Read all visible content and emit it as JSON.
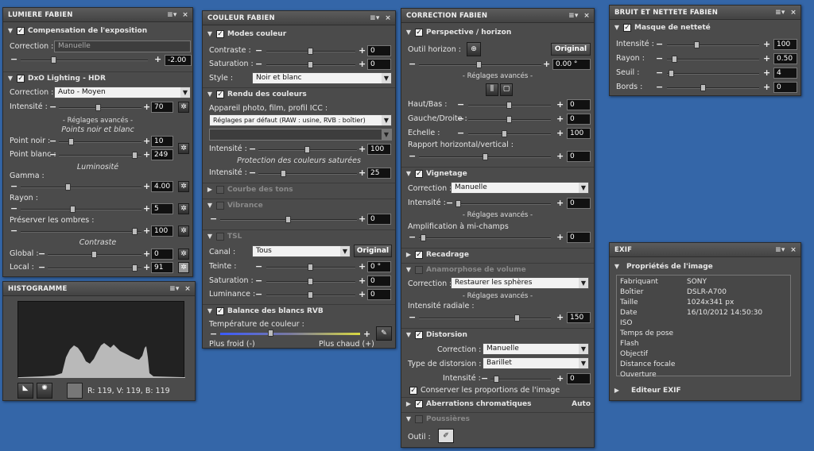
{
  "lumiere": {
    "title": "LUMIERE FABIEN",
    "sec_exposure": "Compensation de l'exposition",
    "correction_label": "Correction :",
    "correction_value": "Manuelle",
    "exposure_value": "-2.00",
    "sec_dxo": "DxO Lighting - HDR",
    "dxo_correction_value": "Auto - Moyen",
    "intensity_label": "Intensité :",
    "intensity_value": "70",
    "advanced": "- Réglages avancés -",
    "points_title": "Points noir et blanc",
    "black_label": "Point noir :",
    "black_value": "10",
    "white_label": "Point blanc :",
    "white_value": "249",
    "luminosity_title": "Luminosité",
    "gamma_label": "Gamma :",
    "gamma_value": "4.00",
    "radius_label": "Rayon :",
    "radius_value": "5",
    "shadows_label": "Préserver les ombres :",
    "shadows_value": "100",
    "contrast_title": "Contraste",
    "global_label": "Global :",
    "global_value": "0",
    "local_label": "Local :",
    "local_value": "91"
  },
  "histogram": {
    "title": "HISTOGRAMME",
    "readout": "R: 119, V: 119, B: 119"
  },
  "couleur": {
    "title": "COULEUR FABIEN",
    "sec_modes": "Modes couleur",
    "contrast_label": "Contraste :",
    "contrast_value": "0",
    "saturation_label": "Saturation :",
    "saturation_value": "0",
    "style_label": "Style :",
    "style_value": "Noir et blanc",
    "sec_render": "Rendu des couleurs",
    "camera_label": "Appareil photo, film, profil ICC :",
    "camera_value": "Réglages par défaut (RAW : usine, RVB : boîtier)",
    "intensity_label": "Intensité :",
    "intensity_value": "100",
    "protection_title": "Protection des couleurs saturées",
    "protection_label": "Intensité :",
    "protection_value": "25",
    "sec_curve": "Courbe des tons",
    "sec_vibrance": "Vibrance",
    "vibrance_value": "0",
    "sec_tsl": "TSL",
    "channel_label": "Canal :",
    "channel_value": "Tous",
    "original_label": "Original",
    "hue_label": "Teinte :",
    "hue_value": "0 °",
    "tsl_sat_label": "Saturation :",
    "tsl_sat_value": "0",
    "luminance_label": "Luminance :",
    "luminance_value": "0",
    "sec_wb": "Balance des blancs RVB",
    "temp_label": "Température de couleur :",
    "cooler": "Plus froid (-)",
    "warmer": "Plus chaud (+)"
  },
  "correction": {
    "title": "CORRECTION FABIEN",
    "sec_perspective": "Perspective / horizon",
    "horizon_label": "Outil horizon :",
    "original_label": "Original",
    "angle_value": "0.00 °",
    "advanced": "- Réglages avancés -",
    "topbottom_label": "Haut/Bas :",
    "topbottom_value": "0",
    "leftright_label": "Gauche/Droite :",
    "leftright_value": "0",
    "scale_label": "Echelle :",
    "scale_value": "100",
    "ratio_label": "Rapport horizontal/vertical :",
    "ratio_value": "0",
    "sec_vignetting": "Vignetage",
    "vig_correction_label": "Correction :",
    "vig_correction_value": "Manuelle",
    "vig_intensity_label": "Intensité :",
    "vig_intensity_value": "0",
    "vig_advanced": "- Réglages avancés -",
    "midfield_label": "Amplification à mi-champs",
    "midfield_value": "0",
    "sec_crop": "Recadrage",
    "sec_anamorph": "Anamorphose de volume",
    "anam_correction_label": "Correction :",
    "anam_correction_value": "Restaurer les sphères",
    "anam_advanced": "- Réglages avancés -",
    "radial_label": "Intensité radiale :",
    "radial_value": "150",
    "sec_distortion": "Distorsion",
    "dist_correction_label": "Correction :",
    "dist_correction_value": "Manuelle",
    "dist_type_label": "Type de distorsion :",
    "dist_type_value": "Barillet",
    "dist_intensity_label": "Intensité :",
    "dist_intensity_value": "0",
    "keep_proportions": "Conserver les proportions de l'image",
    "sec_aberrations": "Aberrations chromatiques",
    "aberrations_mode": "Auto",
    "sec_dust": "Poussières",
    "tool_label": "Outil :"
  },
  "bruit": {
    "title": "BRUIT ET NETTETE FABIEN",
    "sec_mask": "Masque de netteté",
    "intensity_label": "Intensité :",
    "intensity_value": "100",
    "radius_label": "Rayon :",
    "radius_value": "0.50",
    "threshold_label": "Seuil :",
    "threshold_value": "4",
    "edges_label": "Bords :",
    "edges_value": "0"
  },
  "exif": {
    "title": "EXIF",
    "sec_props": "Propriétés de l'image",
    "rows": [
      [
        "Fabriquant",
        "SONY"
      ],
      [
        "Boîtier",
        "DSLR-A700"
      ],
      [
        "Taille",
        "1024x341 px"
      ],
      [
        "Date",
        "16/10/2012 14:50:30"
      ],
      [
        "ISO",
        ""
      ],
      [
        "Temps de pose",
        ""
      ],
      [
        "Flash",
        ""
      ],
      [
        "Objectif",
        ""
      ],
      [
        "Distance focale",
        ""
      ],
      [
        "Ouverture",
        ""
      ]
    ],
    "sec_editor": "Editeur EXIF"
  },
  "window_controls": {
    "menu": "≡▾",
    "close": "×"
  }
}
